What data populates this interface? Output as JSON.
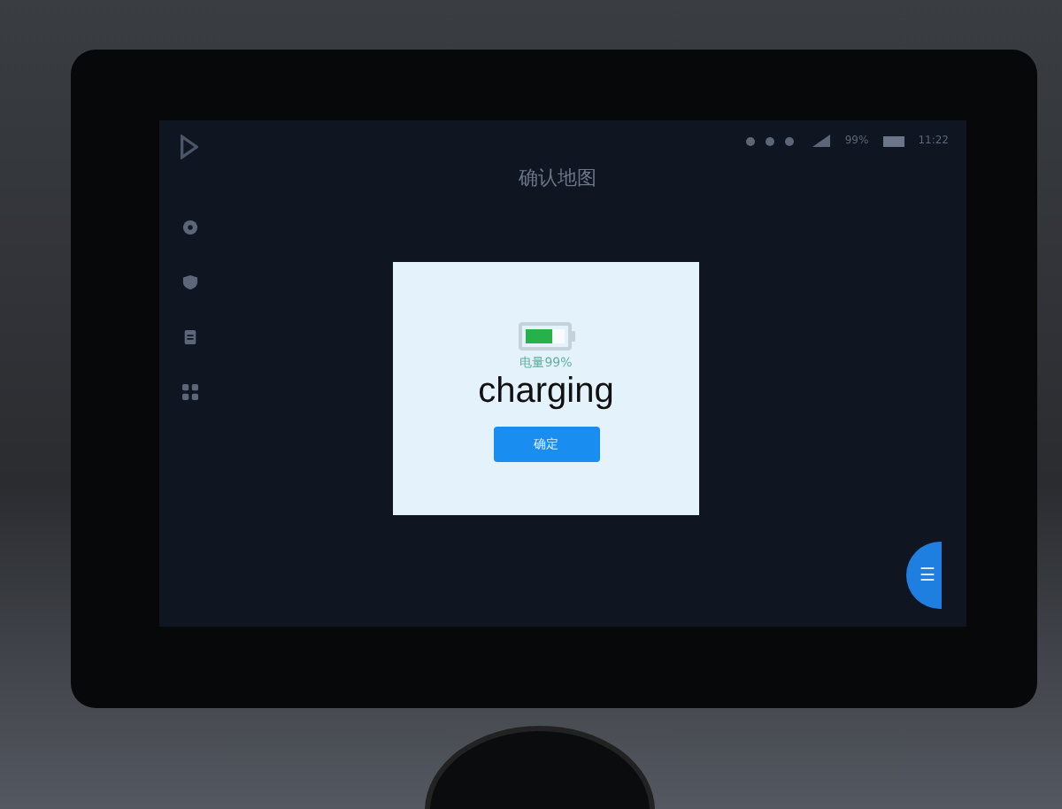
{
  "status_bar": {
    "battery_text": "99%",
    "time": "11:22"
  },
  "title": "确认地图",
  "sidebar": {
    "items": [
      {
        "kind": "pin"
      },
      {
        "kind": "shield"
      },
      {
        "kind": "clipboard"
      },
      {
        "kind": "grid"
      }
    ]
  },
  "dialog": {
    "battery": {
      "level": 0.7
    },
    "battery_text": "电量99%",
    "caption": "charging",
    "button": "确定"
  },
  "menu_button": {
    "label": "☰"
  }
}
